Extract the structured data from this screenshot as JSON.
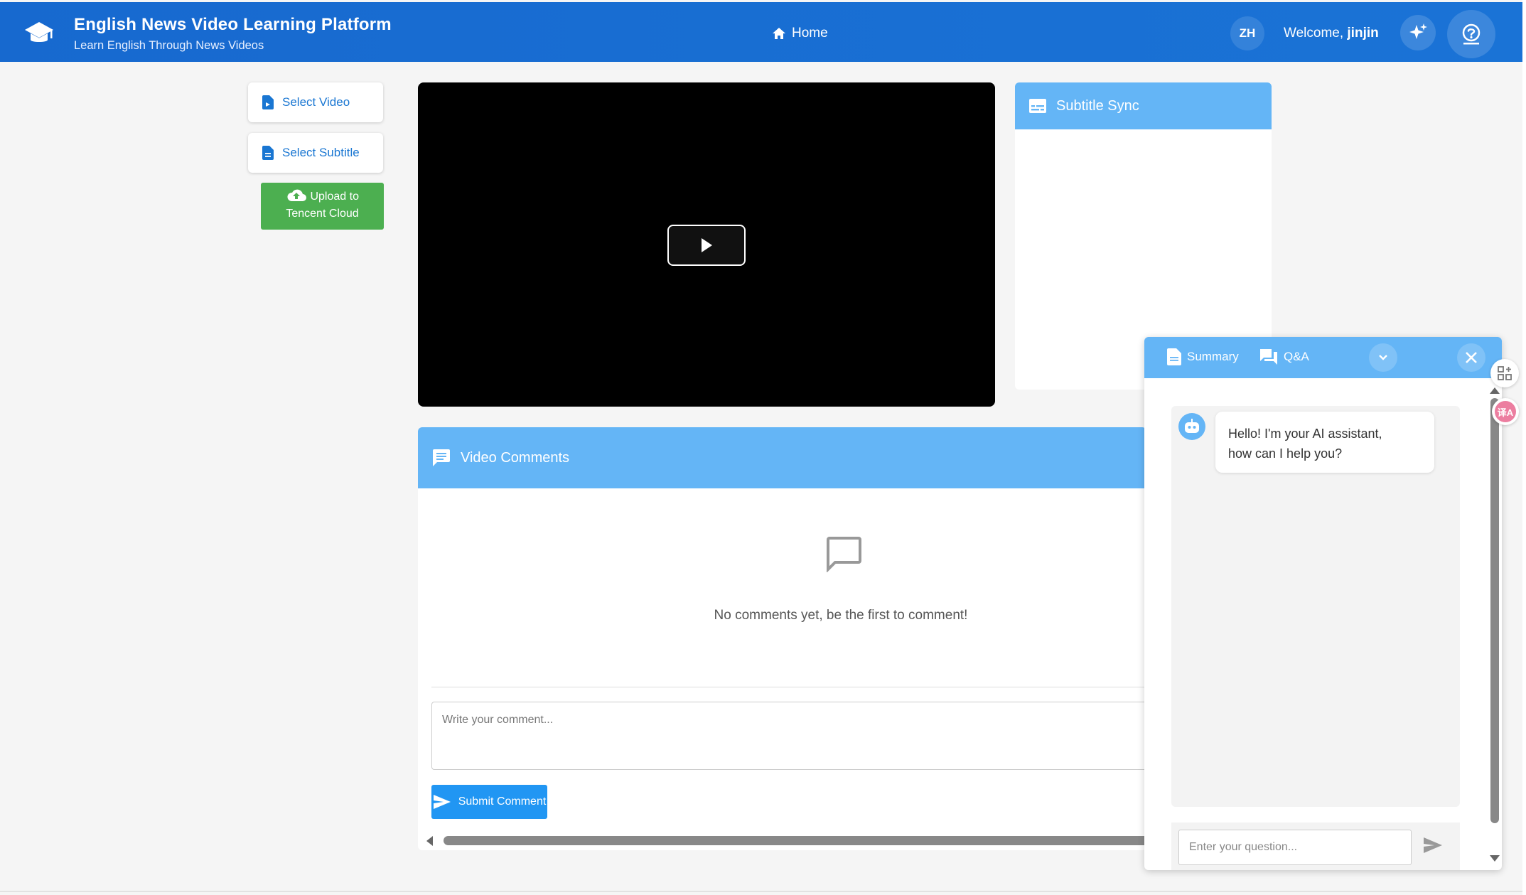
{
  "header": {
    "title": "English News Video Learning Platform",
    "subtitle": "Learn English Through News Videos",
    "nav_home": "Home",
    "lang": "ZH",
    "welcome_prefix": "Welcome,",
    "username": "jinjin",
    "icons": [
      "graduation-cap-icon",
      "home-icon",
      "sparkle-icon",
      "help-circle-icon"
    ]
  },
  "sidebar": {
    "select_video": "Select Video",
    "select_subtitle": "Select Subtitle",
    "upload_line1": "Upload to",
    "upload_line2": "Tencent Cloud"
  },
  "subtitle_panel": {
    "title": "Subtitle Sync"
  },
  "comments": {
    "title": "Video Comments",
    "empty_text": "No comments yet, be the first to comment!",
    "input_placeholder": "Write your comment...",
    "submit_label": "Submit Comment"
  },
  "assistant": {
    "tab_summary": "Summary",
    "tab_qa": "Q&A",
    "greeting_line1": "Hello! I'm your AI assistant,",
    "greeting_line2": "how can I help you?",
    "input_placeholder": "Enter your question..."
  },
  "float_translate_label": "译A",
  "colors": {
    "header_blue": "#1a6fd1",
    "panel_blue": "#64b5f6",
    "primary": "#2196f3",
    "upload_green": "#4caf50"
  }
}
